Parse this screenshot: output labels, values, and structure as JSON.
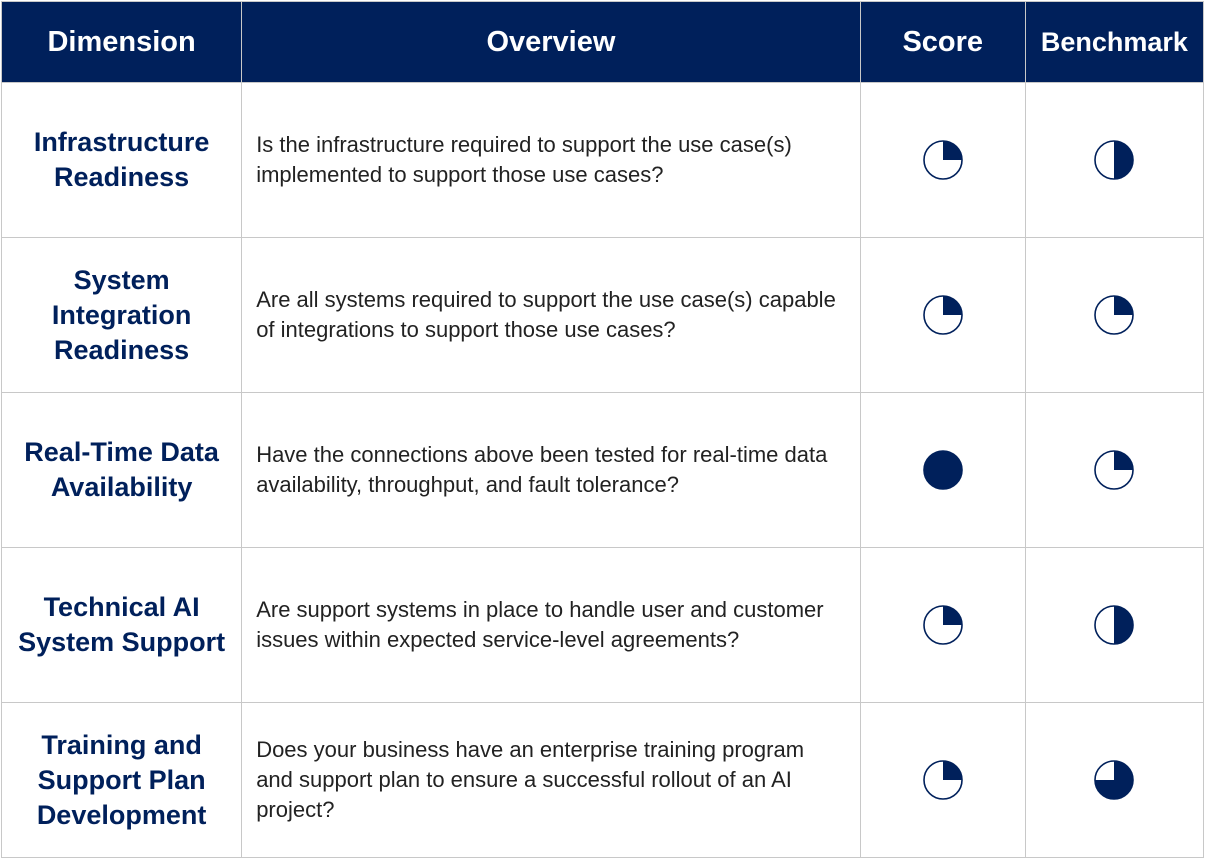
{
  "colors": {
    "header_bg": "#00205b",
    "accent": "#00205b",
    "border": "#c8c8c8"
  },
  "headers": {
    "dimension": "Dimension",
    "overview": "Overview",
    "score": "Score",
    "benchmark": "Benchmark"
  },
  "rows": [
    {
      "dimension": "Infrastructure Readiness",
      "overview": "Is the infrastructure required to support the use case(s) implemented to support those use cases?",
      "score": 0.25,
      "benchmark": 0.5
    },
    {
      "dimension": "System Integration Readiness",
      "overview": "Are all systems required to support the use case(s) capable of integrations to support those use cases?",
      "score": 0.25,
      "benchmark": 0.25
    },
    {
      "dimension": "Real-Time Data Availability",
      "overview": "Have the connections above been tested for real-time data availability, throughput, and fault tolerance?",
      "score": 1.0,
      "benchmark": 0.25
    },
    {
      "dimension": "Technical AI System Support",
      "overview": "Are support systems in place to handle user and customer issues within expected service-level agreements?",
      "score": 0.25,
      "benchmark": 0.5
    },
    {
      "dimension": "Training and Support Plan Development",
      "overview": "Does your business have an enterprise training program and support plan to ensure a successful rollout of an AI project?",
      "score": 0.25,
      "benchmark": 0.75
    }
  ],
  "icons": {
    "rating": "harvey-ball-icon"
  }
}
